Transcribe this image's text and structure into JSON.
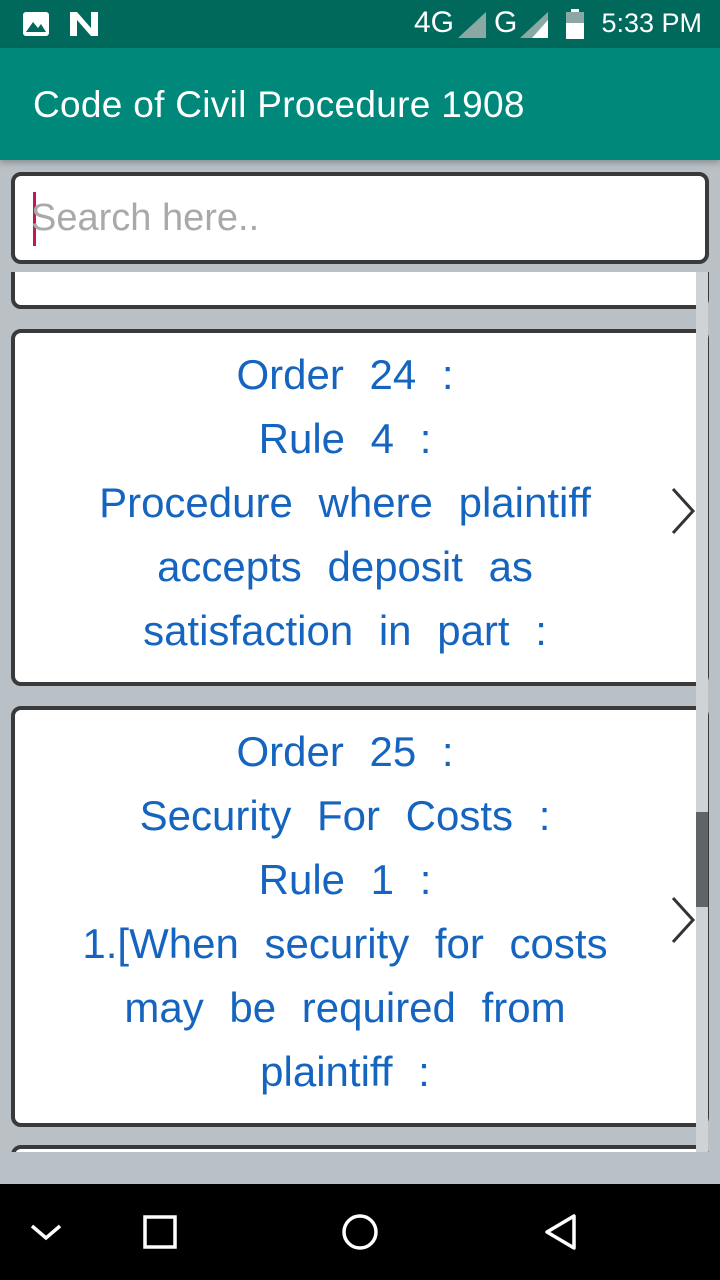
{
  "status_bar": {
    "time": "5:33 PM",
    "network_1": "4G",
    "network_2": "G",
    "icons": [
      "image-icon",
      "n-notification-icon",
      "signal-icon",
      "battery-icon"
    ]
  },
  "app_bar": {
    "title": "Code of Civil Procedure 1908"
  },
  "search": {
    "placeholder": "Search here..",
    "value": ""
  },
  "cards": [
    {
      "lines": []
    },
    {
      "lines": [
        "Order 24 :",
        "Rule 4 :",
        "Procedure where plaintiff",
        "accepts deposit as",
        "satisfaction in part :"
      ]
    },
    {
      "lines": [
        "Order 25 :",
        "Security For Costs :",
        "Rule 1 :",
        "1.[When security for costs",
        "may be required from",
        "plaintiff :"
      ]
    }
  ],
  "nav_bar": {
    "icons": [
      "chevron-down-icon",
      "recents-icon",
      "home-icon",
      "back-icon"
    ]
  },
  "colors": {
    "status_bar": "#00695c",
    "app_bar": "#00897b",
    "card_text": "#1565c0",
    "background": "#b9c1c7",
    "caret": "#c2185b"
  }
}
